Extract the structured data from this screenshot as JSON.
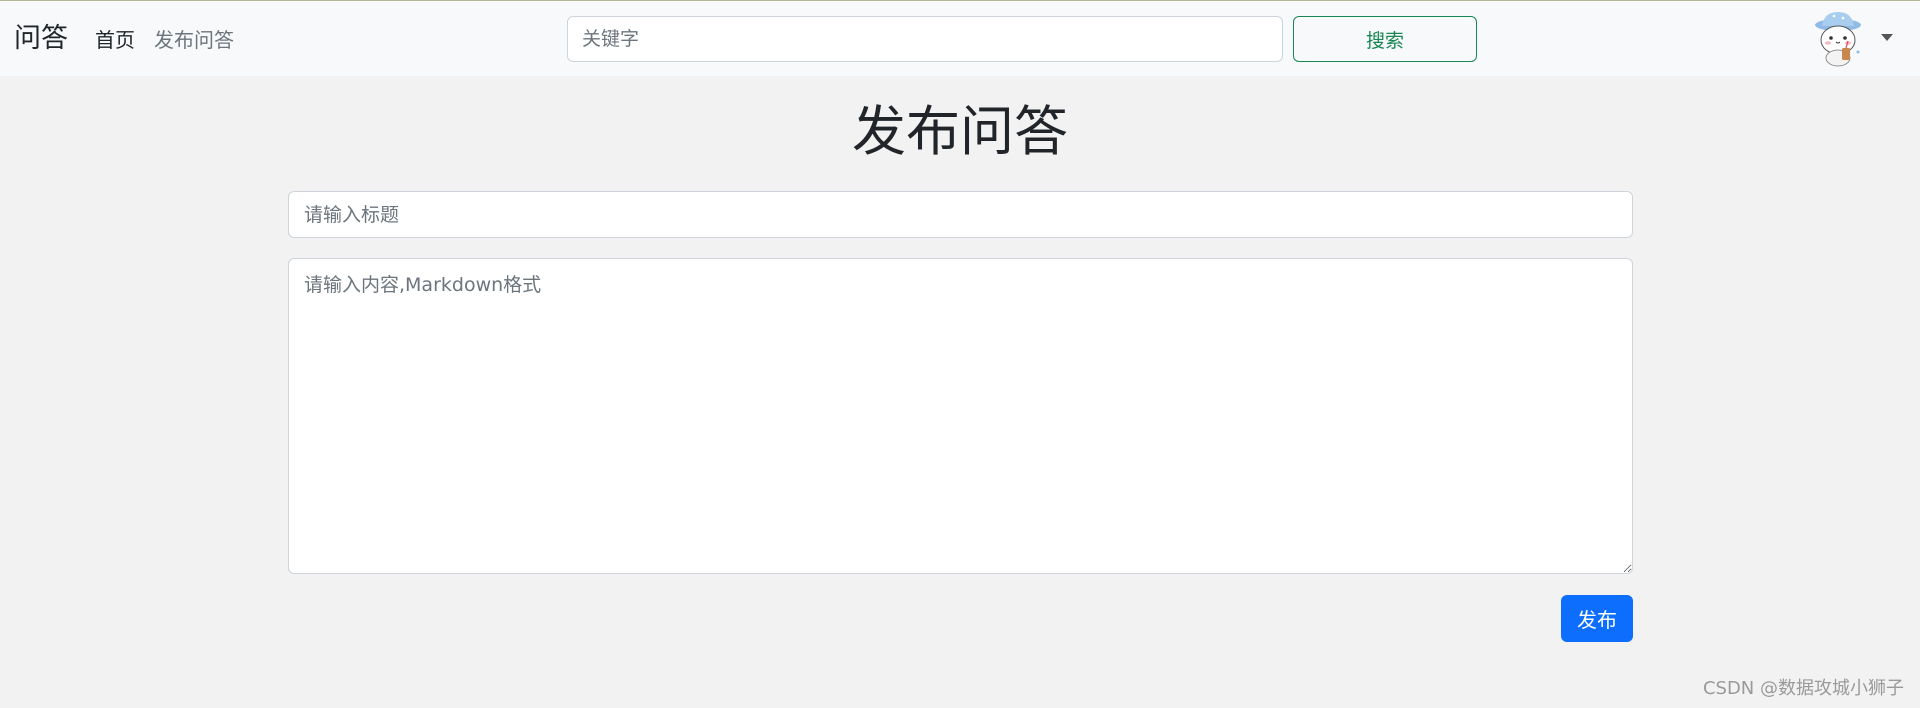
{
  "navbar": {
    "brand": "问答",
    "links": [
      {
        "label": "首页"
      },
      {
        "label": "发布问答"
      }
    ],
    "search": {
      "placeholder": "关键字",
      "value": "",
      "button_label": "搜索"
    },
    "avatar": {
      "icon": "user-avatar-cartoon"
    },
    "dropdown_icon": "caret-down-icon"
  },
  "main": {
    "title": "发布问答",
    "title_field": {
      "placeholder": "请输入标题",
      "value": ""
    },
    "content_field": {
      "placeholder": "请输入内容,Markdown格式",
      "value": ""
    },
    "submit_label": "发布"
  },
  "footer": {
    "watermark": "CSDN @数据攻城小狮子"
  },
  "colors": {
    "primary": "#0d6efd",
    "success": "#198754",
    "background": "#f2f2f2",
    "navbar_bg": "#f8f9fa"
  }
}
